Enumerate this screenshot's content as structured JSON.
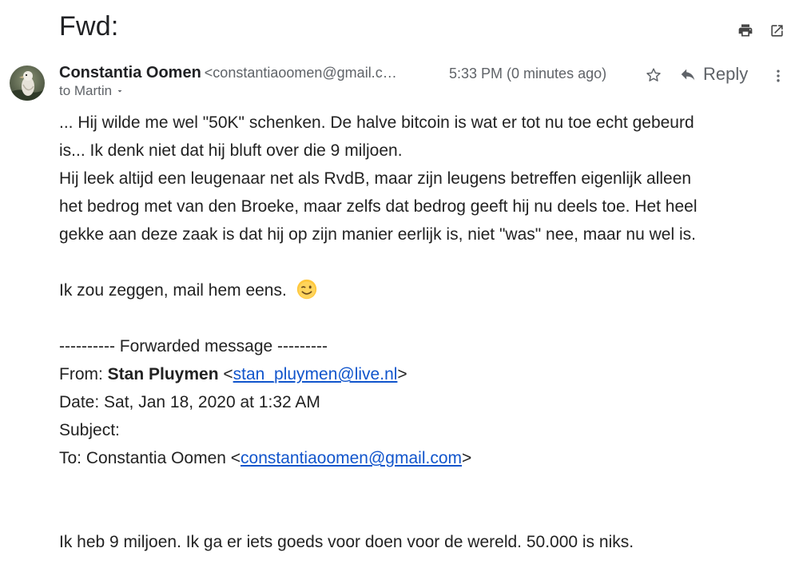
{
  "email": {
    "subject": "Fwd:",
    "sender": {
      "name": "Constantia Oomen",
      "email_display": "<constantiaoomen@gmail.c…"
    },
    "time": "5:33 PM (0 minutes ago)",
    "reply_label": "Reply",
    "to_line": "to Martin",
    "body": {
      "paragraph1_line1": "... Hij wilde me wel \"50K\" schenken. De halve bitcoin is wat er tot nu toe echt gebeurd",
      "paragraph1_line2": "is... Ik denk niet dat hij bluft over die 9 miljoen.",
      "paragraph2_line1": "Hij leek altijd een leugenaar net als RvdB, maar zijn leugens betreffen eigenlijk alleen",
      "paragraph2_line2": "het bedrog met van den Broeke, maar zelfs dat bedrog geeft hij nu deels toe. Het heel",
      "paragraph2_line3": "gekke aan deze zaak is dat hij op zijn manier eerlijk is, niet \"was\" nee, maar nu wel is.",
      "paragraph3": "Ik zou zeggen, mail hem eens.",
      "forwarded_header": "---------- Forwarded message ---------",
      "from_label": "From: ",
      "from_name": "Stan Pluymen",
      "from_email": "stan_pluymen@live.nl",
      "date_line": "Date: Sat, Jan 18, 2020 at 1:32 AM",
      "subject_line": "Subject:",
      "to_label": "To: Constantia Oomen ",
      "to_email": "constantiaoomen@gmail.com",
      "final_line": "Ik heb 9 miljoen. Ik ga er iets goeds voor doen voor de wereld. 50.000 is niks."
    }
  },
  "icons": {
    "print": "print-icon",
    "open_new_window": "open-in-new-window-icon",
    "star": "star-icon",
    "reply": "reply-icon",
    "more": "more-vertical-icon",
    "dropdown": "chevron-down-icon",
    "emoji": "winking-face-emoji"
  },
  "colors": {
    "link": "#1155cc",
    "secondary_text": "#5f6368",
    "body_text": "#222222",
    "emoji_face": "#ffc83d"
  }
}
